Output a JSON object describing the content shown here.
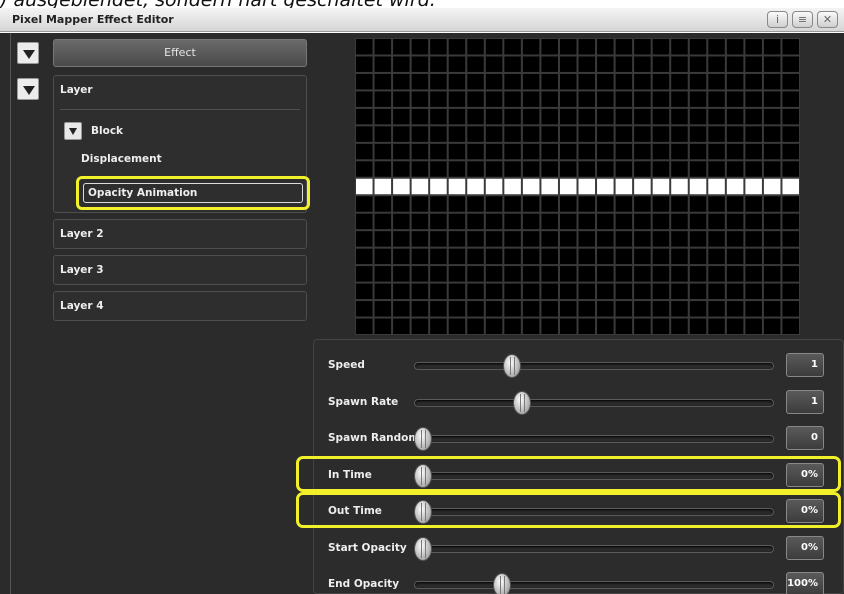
{
  "caption": ") ausgeblendet, sondern hart geschaltet wird.",
  "window": {
    "title": "Pixel Mapper Effect Editor",
    "buttons": [
      "i",
      "≡",
      "✕"
    ]
  },
  "left_panel": {
    "effect_label": "Effect",
    "layers": [
      {
        "label": "Layer",
        "expanded": true,
        "block_label": "Block",
        "items": [
          "Displacement",
          "Opacity Animation"
        ]
      },
      {
        "label": "Layer 2"
      },
      {
        "label": "Layer 3"
      },
      {
        "label": "Layer 4"
      }
    ]
  },
  "pixel_grid": {
    "columns": 24,
    "rows": 17,
    "lit_row": 8
  },
  "sliders": [
    {
      "label": "Speed",
      "value": "1",
      "position": 0.26,
      "highlighted": false
    },
    {
      "label": "Spawn Rate",
      "value": "1",
      "position": 0.29,
      "highlighted": false
    },
    {
      "label": "Spawn Random",
      "value": "0",
      "position": 0.0,
      "highlighted": false
    },
    {
      "label": "In Time",
      "value": "0%",
      "position": 0.0,
      "highlighted": true
    },
    {
      "label": "Out Time",
      "value": "0%",
      "position": 0.0,
      "highlighted": true
    },
    {
      "label": "Start Opacity",
      "value": "0%",
      "position": 0.0,
      "highlighted": false
    },
    {
      "label": "End Opacity",
      "value": "100%",
      "position": 0.23,
      "highlighted": false
    }
  ],
  "colors": {
    "background": "#2b2b2b",
    "highlight": "#f2f02a",
    "pixel_off": "#000000",
    "pixel_on": "#ffffff"
  }
}
